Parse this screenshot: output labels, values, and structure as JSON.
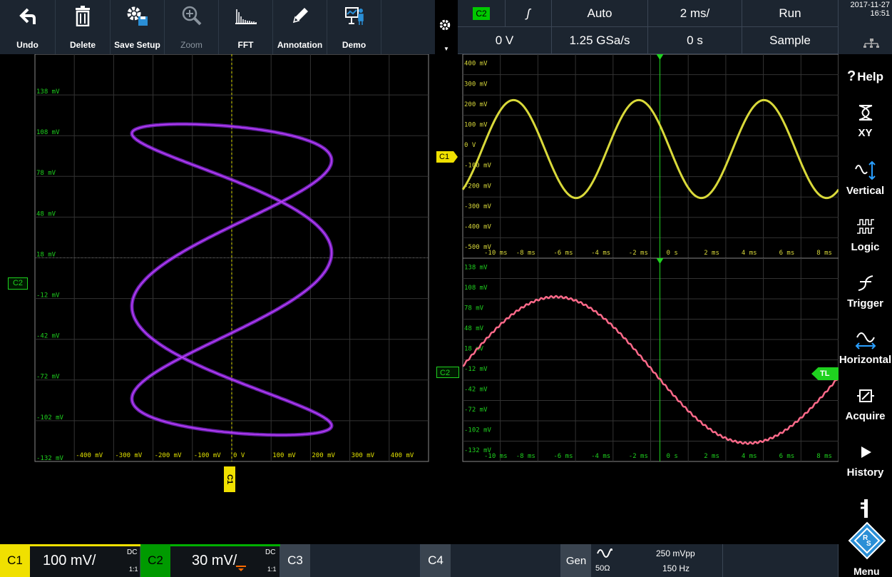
{
  "toolbar": {
    "undo": "Undo",
    "delete": "Delete",
    "save_setup": "Save Setup",
    "zoom": "Zoom",
    "fft": "FFT",
    "annotation": "Annotation",
    "demo": "Demo"
  },
  "trigger": {
    "source": "C2",
    "slope": "ʃ",
    "mode": "Auto",
    "time_scale": "2 ms/",
    "run_state": "Run",
    "level": "0 V",
    "sample_rate": "1.25 GSa/s",
    "offset": "0 s",
    "acq_mode": "Sample"
  },
  "datetime": {
    "date": "2017-11-27",
    "time": "16:51"
  },
  "sidebar": {
    "help": "Help",
    "xy": "XY",
    "vertical": "Vertical",
    "logic": "Logic",
    "trigger": "Trigger",
    "horizontal": "Horizontal",
    "acquire": "Acquire",
    "history": "History",
    "menu": "Menu"
  },
  "xy_plot": {
    "y_labels": [
      "138 mV",
      "108 mV",
      "78 mV",
      "48 mV",
      "18 mV",
      "-12 mV",
      "-42 mV",
      "-72 mV",
      "-102 mV",
      "-132 mV"
    ],
    "x_labels": [
      "-400 mV",
      "-300 mV",
      "-200 mV",
      "-100 mV",
      "0 V",
      "100 mV",
      "200 mV",
      "300 mV",
      "400 mV"
    ],
    "y_marker": "C2",
    "x_marker": "C1"
  },
  "c1_plot": {
    "y_labels": [
      "400 mV",
      "300 mV",
      "200 mV",
      "100 mV",
      "0 V",
      "-100 mV",
      "-200 mV",
      "-300 mV",
      "-400 mV",
      "-500 mV"
    ],
    "x_labels": [
      "-10 ms",
      "-8 ms",
      "-6 ms",
      "-4 ms",
      "-2 ms",
      "0 s",
      "2 ms",
      "4 ms",
      "6 ms",
      "8 ms"
    ],
    "marker": "C1",
    "color": "#d9d93a"
  },
  "c2_plot": {
    "y_labels": [
      "138 mV",
      "108 mV",
      "78 mV",
      "48 mV",
      "18 mV",
      "-12 mV",
      "-42 mV",
      "-72 mV",
      "-102 mV",
      "-132 mV"
    ],
    "x_labels": [
      "-10 ms",
      "-8 ms",
      "-6 ms",
      "-4 ms",
      "-2 ms",
      "0 s",
      "2 ms",
      "4 ms",
      "6 ms",
      "8 ms"
    ],
    "marker": "C2",
    "tl": "TL",
    "color": "#ff6a8a"
  },
  "channels": {
    "c1": {
      "name": "C1",
      "scale": "100 mV/",
      "coupling": "DC",
      "ratio": "1:1",
      "color": "#ffff00"
    },
    "c2": {
      "name": "C2",
      "scale": "30 mV/",
      "coupling": "DC",
      "ratio": "1:1",
      "color": "#00b000"
    },
    "c3": {
      "name": "C3"
    },
    "c4": {
      "name": "C4"
    },
    "gen": {
      "name": "Gen",
      "impedance": "50Ω",
      "amplitude": "250 mVpp",
      "frequency": "150 Hz"
    }
  }
}
